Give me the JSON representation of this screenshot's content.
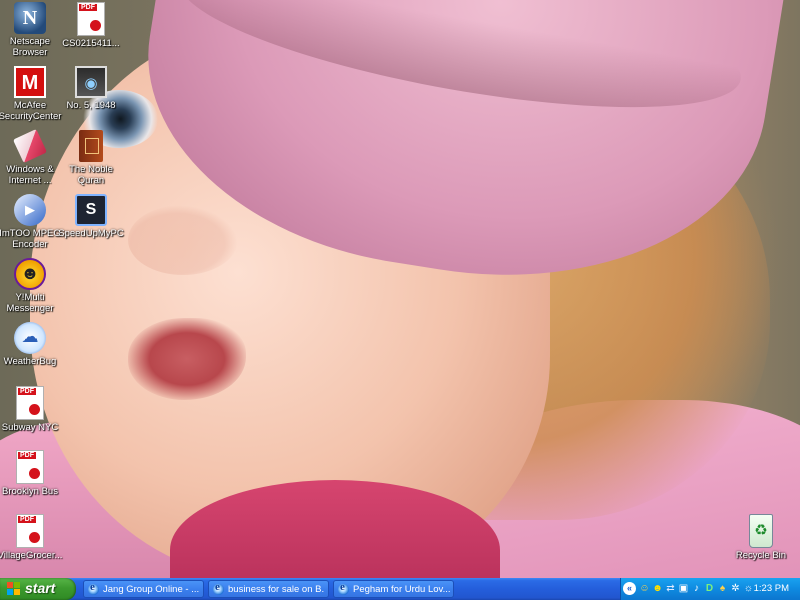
{
  "desktop": {
    "icons": [
      {
        "label": "Netscape Browser",
        "icon": "netscape-icon"
      },
      {
        "label": "CS0215411...",
        "icon": "pdf-file-icon"
      },
      {
        "label": "McAfee SecurityCenter",
        "icon": "mcafee-icon"
      },
      {
        "label": "No. 5, 1948",
        "icon": "image-file-icon"
      },
      {
        "label": "Windows & Internet ...",
        "icon": "eraser-icon"
      },
      {
        "label": "The Noble Quran",
        "icon": "book-icon"
      },
      {
        "label": "ImTOO MPEG Encoder",
        "icon": "imtoo-encoder-icon"
      },
      {
        "label": "SpeedUpMyPC",
        "icon": "speedupmypc-icon"
      },
      {
        "label": "Y!Multi Messenger",
        "icon": "yahoo-messenger-icon"
      },
      {
        "label": "WeatherBug",
        "icon": "weatherbug-icon"
      },
      {
        "label": "Subway NYC",
        "icon": "pdf-file-icon"
      },
      {
        "label": "Brooklyn Bus",
        "icon": "pdf-file-icon"
      },
      {
        "label": "VillageGrocer...",
        "icon": "pdf-file-icon"
      },
      {
        "label": "Recycle Bin",
        "icon": "recycle-bin-icon"
      }
    ]
  },
  "taskbar": {
    "start_label": "start",
    "tasks": [
      {
        "label": "Jang Group Online - ...",
        "icon": "internet-explorer-icon"
      },
      {
        "label": "business for sale on B...",
        "icon": "internet-explorer-icon"
      },
      {
        "label": "Pegham for Urdu Lov...",
        "icon": "internet-explorer-icon"
      }
    ],
    "tray": {
      "chevron": "«",
      "icons": [
        "messenger-tray-icon",
        "yahoo-tray-icon",
        "network-tray-icon",
        "display-tray-icon",
        "sound-tray-icon",
        "d-tray-icon",
        "security-tray-icon",
        "wireless-tray-icon",
        "weatherbug-tray-icon"
      ],
      "clock": "1:23 PM"
    }
  },
  "colors": {
    "taskbar_blue": "#245edb",
    "start_green": "#3c9a2e",
    "tray_blue": "#0f8ae0"
  }
}
